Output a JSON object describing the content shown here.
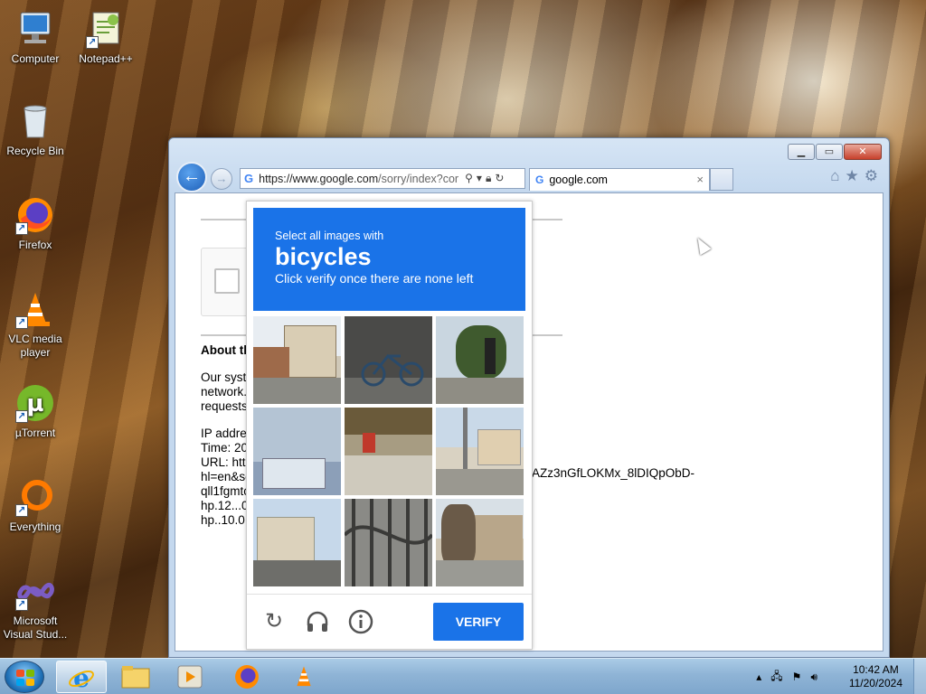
{
  "desktop": {
    "icons": [
      {
        "label": "Computer"
      },
      {
        "label": "Notepad++"
      },
      {
        "label": "Recycle Bin"
      },
      {
        "label": "Firefox"
      },
      {
        "label": "VLC media player"
      },
      {
        "label": "µTorrent"
      },
      {
        "label": "Everything"
      },
      {
        "label": "Microsoft Visual Stud..."
      }
    ]
  },
  "browser": {
    "url_prefix": "https://www.google.com",
    "url_rest": "/sorry/index?cor",
    "tab_title": "google.com",
    "tab_close": "×",
    "page": {
      "heading": "About th",
      "para1": "Our syste\nnetwork.\nrequests",
      "info": "IP addres\nTime: 20\nURL: http\nhl=en&sc\nqll1fgmtc\nhp.12...0\nhp..10.0.",
      "url_tail": "AZz3nGfLOKMx_8lDIQpObD-"
    }
  },
  "captcha": {
    "prompt_pre": "Select all images with",
    "target": "bicycles",
    "prompt_post": "Click verify once there are none left",
    "verify_label": "VERIFY",
    "tiles": [
      {
        "name": "house-street"
      },
      {
        "name": "bicycle-wall"
      },
      {
        "name": "traffic-light-trees"
      },
      {
        "name": "shop-storefront"
      },
      {
        "name": "market-stall"
      },
      {
        "name": "street-utility-pole"
      },
      {
        "name": "apartment-building"
      },
      {
        "name": "metal-gate"
      },
      {
        "name": "house-tree"
      }
    ]
  },
  "taskbar": {
    "time": "10:42 AM",
    "date": "11/20/2024"
  },
  "colors": {
    "captcha_blue": "#1a73e8",
    "ie_frame": "#c4d8ee"
  }
}
